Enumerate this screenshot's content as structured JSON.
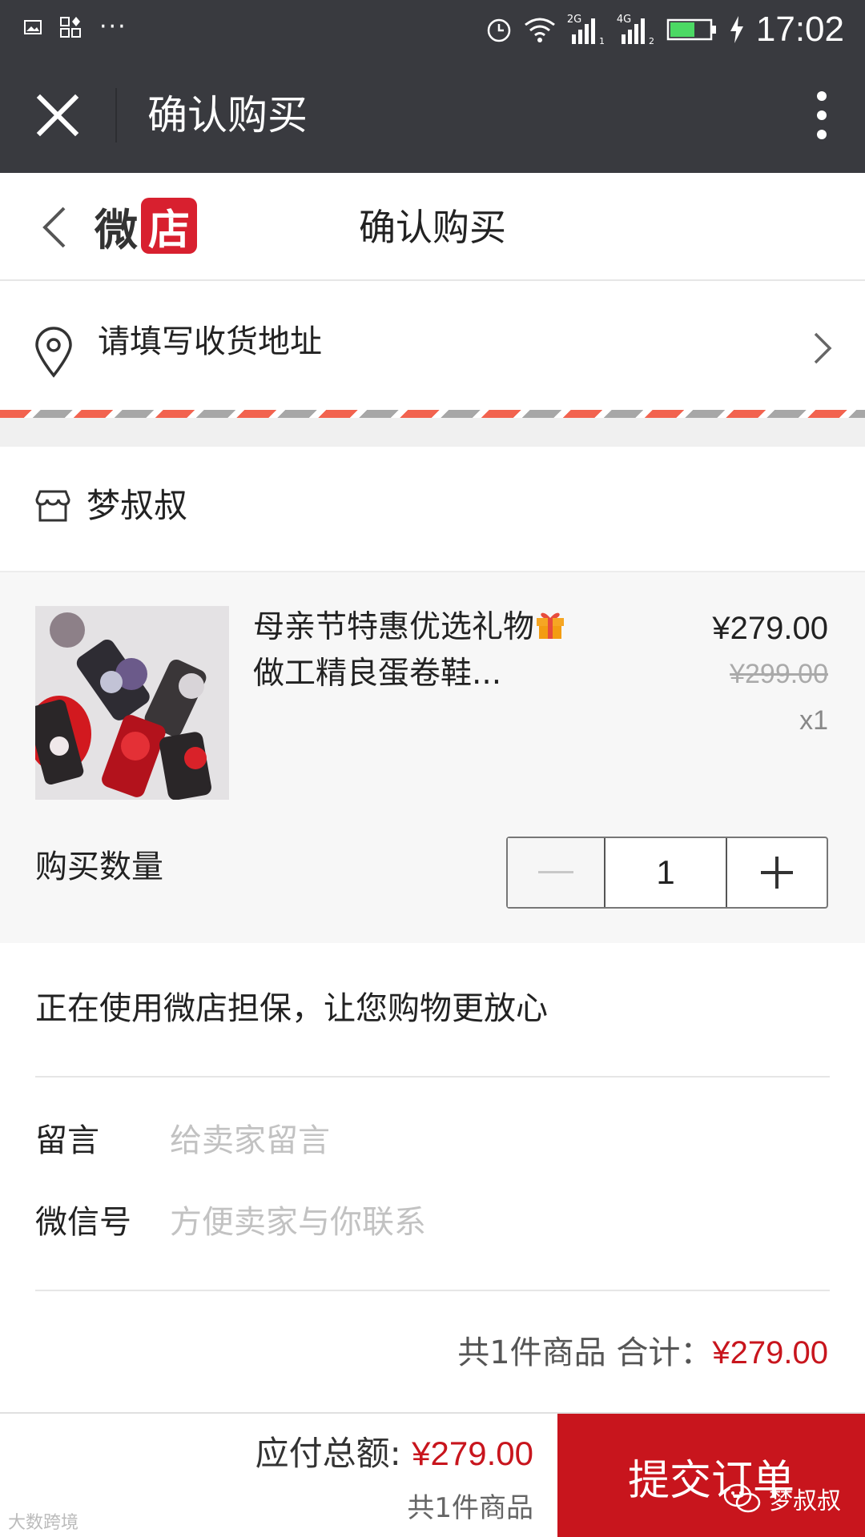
{
  "status_bar": {
    "net_2g": "2G",
    "net_4g": "4G",
    "time": "17:02"
  },
  "app_bar": {
    "title": "确认购买"
  },
  "page_header": {
    "logo_left": "微",
    "logo_right": "店",
    "title": "确认购买"
  },
  "address": {
    "placeholder_text": "请填写收货地址"
  },
  "shop": {
    "name": "梦叔叔"
  },
  "item": {
    "title": "母亲节特惠优选礼物",
    "subtitle": "做工精良蛋卷鞋...",
    "price": "¥279.00",
    "original_price": "¥299.00",
    "quantity_mark": "x1",
    "quantity_label": "购买数量",
    "quantity_value": "1"
  },
  "guarantee_text": "正在使用微店担保，让您购物更放心",
  "form": {
    "message_label": "留言",
    "message_placeholder": "给卖家留言",
    "wechat_label": "微信号",
    "wechat_placeholder": "方便卖家与你联系"
  },
  "summary": {
    "prefix": "共1件商品 合计：",
    "amount": "¥279.00"
  },
  "bottom_bar": {
    "total_label": "应付总额: ",
    "total_amount": "¥279.00",
    "item_count": "共1件商品",
    "submit_label": "提交订单"
  },
  "watermark": {
    "text": "梦叔叔",
    "corner_text": "大数跨境"
  },
  "colors": {
    "accent_red": "#c8151d",
    "title_bar": "#393a3f"
  }
}
